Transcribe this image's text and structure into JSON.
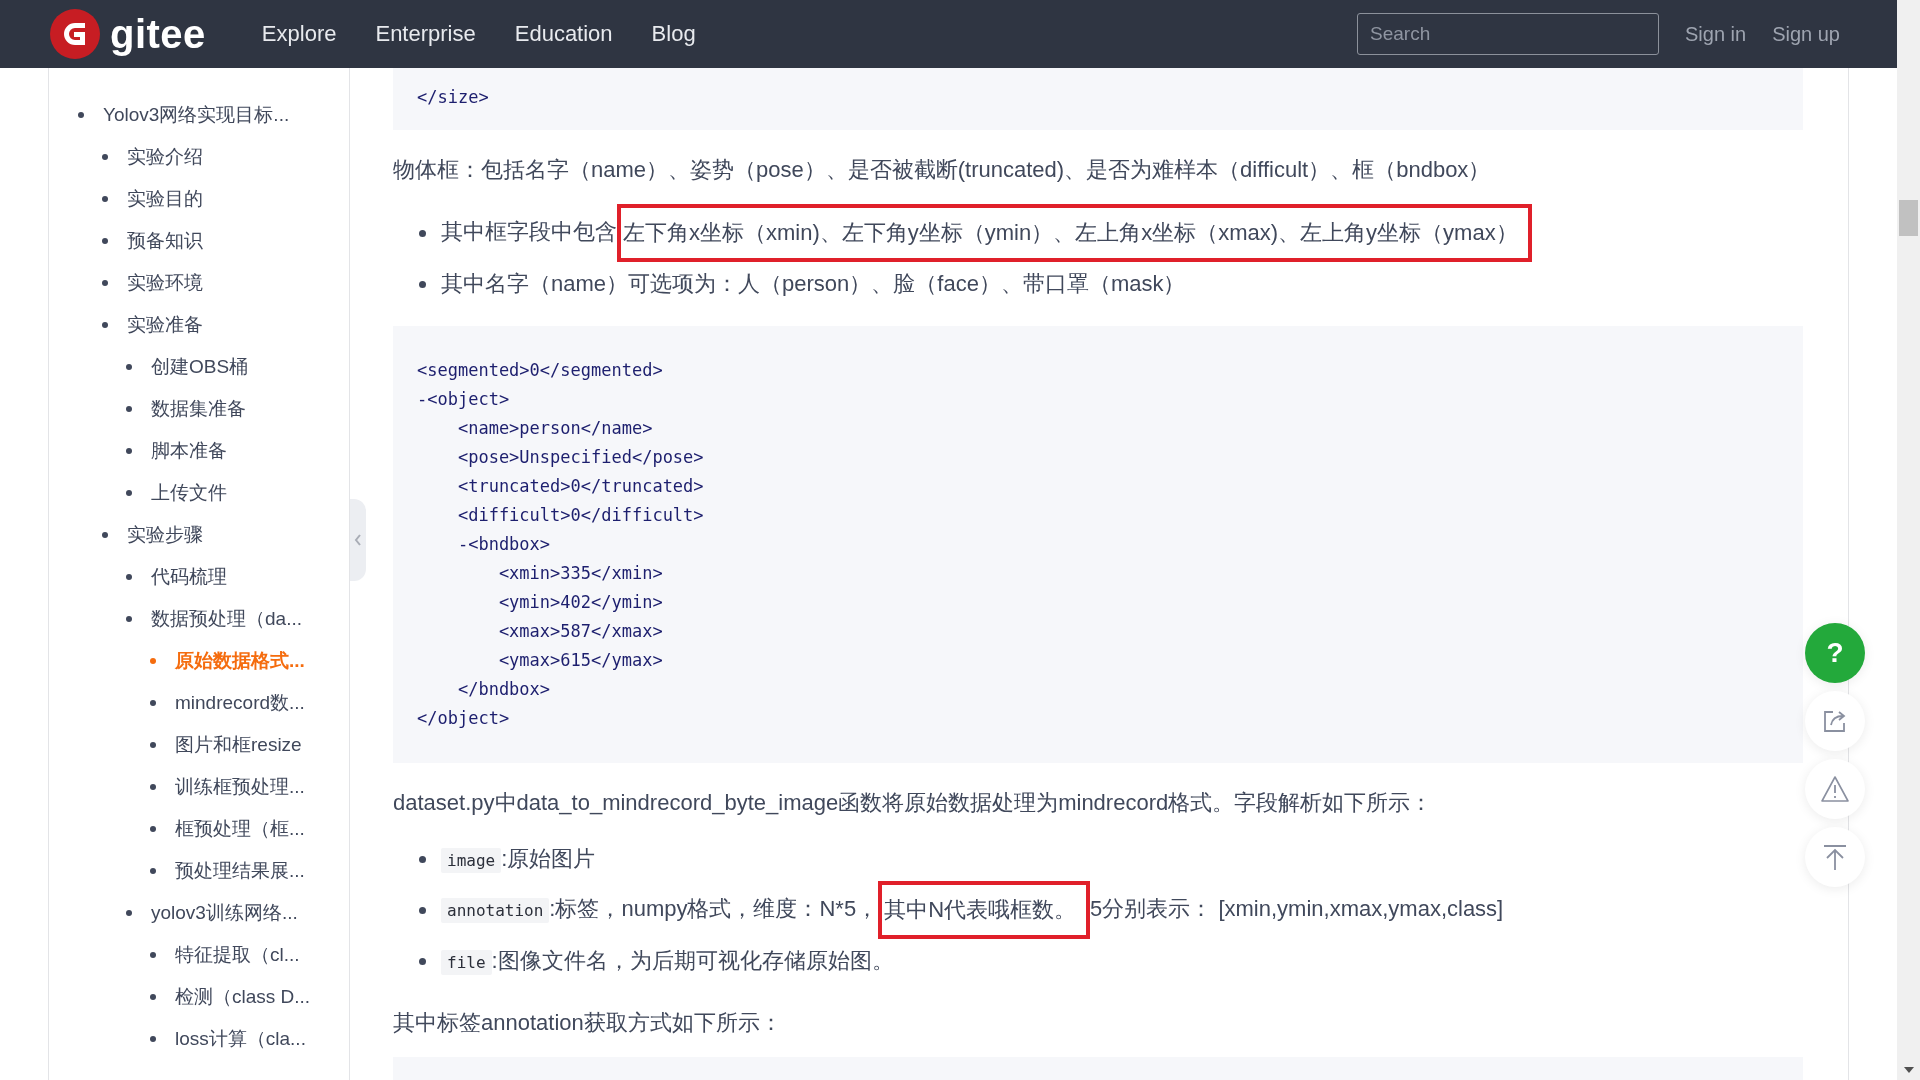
{
  "header": {
    "logo": "gitee",
    "nav": [
      "Explore",
      "Enterprise",
      "Education",
      "Blog"
    ],
    "search": {
      "placeholder": "Search"
    },
    "actions": [
      "Sign in",
      "Sign up"
    ]
  },
  "sidebar": {
    "items": [
      {
        "label": "Yolov3网络实现目标...",
        "selected": false,
        "children": [
          {
            "label": "实验介绍",
            "selected": false
          },
          {
            "label": "实验目的",
            "selected": false
          },
          {
            "label": "预备知识",
            "selected": false
          },
          {
            "label": "实验环境",
            "selected": false
          },
          {
            "label": "实验准备",
            "selected": false,
            "children": [
              {
                "label": "创建OBS桶",
                "selected": false
              },
              {
                "label": "数据集准备",
                "selected": false
              },
              {
                "label": "脚本准备",
                "selected": false
              },
              {
                "label": "上传文件",
                "selected": false
              }
            ]
          },
          {
            "label": "实验步骤",
            "selected": false,
            "children": [
              {
                "label": "代码梳理",
                "selected": false
              },
              {
                "label": "数据预处理（da...",
                "selected": false,
                "children": [
                  {
                    "label": "原始数据格式...",
                    "selected": true
                  },
                  {
                    "label": "mindrecord数...",
                    "selected": false
                  },
                  {
                    "label": "图片和框resize",
                    "selected": false
                  },
                  {
                    "label": "训练框预处理...",
                    "selected": false
                  },
                  {
                    "label": "框预处理（框...",
                    "selected": false
                  },
                  {
                    "label": "预处理结果展...",
                    "selected": false
                  }
                ]
              },
              {
                "label": "yolov3训练网络...",
                "selected": false,
                "children": [
                  {
                    "label": "特征提取（cl...",
                    "selected": false
                  },
                  {
                    "label": "检测（class D...",
                    "selected": false
                  },
                  {
                    "label": "loss计算（cla...",
                    "selected": false
                  }
                ]
              }
            ]
          }
        ]
      }
    ]
  },
  "content": {
    "blocks": [
      {
        "kind": "code",
        "lines": [
          "</size>"
        ]
      },
      {
        "kind": "paragraph",
        "text": "物体框：包括名字（name）、姿势（pose）、是否被截断(truncated)、是否为难样本（difficult）、框（bndbox）"
      },
      {
        "kind": "list",
        "items": [
          {
            "parts": [
              {
                "kind": "text",
                "text": "其中框字段中包含"
              },
              {
                "kind": "boxed",
                "text": "左下角x坐标（xmin)、左下角y坐标（ymin）、左上角x坐标（xmax)、左上角y坐标（ymax）"
              }
            ]
          },
          {
            "parts": [
              {
                "kind": "text",
                "text": "其中名字（name）可选项为：人（person）、脸（face）、带口罩（mask）"
              }
            ]
          }
        ]
      },
      {
        "kind": "code",
        "lines": [
          "<segmented>0</segmented>",
          "-<object>",
          "    <name>person</name>",
          "    <pose>Unspecified</pose>",
          "    <truncated>0</truncated>",
          "    <difficult>0</difficult>",
          "    -<bndbox>",
          "        <xmin>335</xmin>",
          "        <ymin>402</ymin>",
          "        <xmax>587</xmax>",
          "        <ymax>615</ymax>",
          "    </bndbox>",
          "</object>"
        ]
      },
      {
        "kind": "paragraph",
        "text": "dataset.py中data_to_mindrecord_byte_image函数将原始数据处理为mindrecord格式。字段解析如下所示："
      },
      {
        "kind": "list",
        "items": [
          {
            "parts": [
              {
                "kind": "code",
                "text": "image"
              },
              {
                "kind": "text",
                "text": ":原始图片"
              }
            ]
          },
          {
            "parts": [
              {
                "kind": "code",
                "text": "annotation"
              },
              {
                "kind": "text",
                "text": ":标签，numpy格式，维度：N*5，"
              },
              {
                "kind": "boxed",
                "text": "其中N代表哦框数。"
              },
              {
                "kind": "text",
                "text": "5分别表示： [xmin,ymin,xmax,ymax,class]"
              }
            ]
          },
          {
            "parts": [
              {
                "kind": "code",
                "text": "file"
              },
              {
                "kind": "text",
                "text": ":图像文件名，为后期可视化存储原始图。"
              }
            ]
          }
        ]
      },
      {
        "kind": "paragraph",
        "text": "其中标签annotation获取方式如下所示："
      },
      {
        "kind": "code"
      }
    ]
  },
  "float_buttons": [
    {
      "kind": "help",
      "label": "?"
    },
    {
      "kind": "share"
    },
    {
      "kind": "report"
    },
    {
      "kind": "top"
    }
  ]
}
